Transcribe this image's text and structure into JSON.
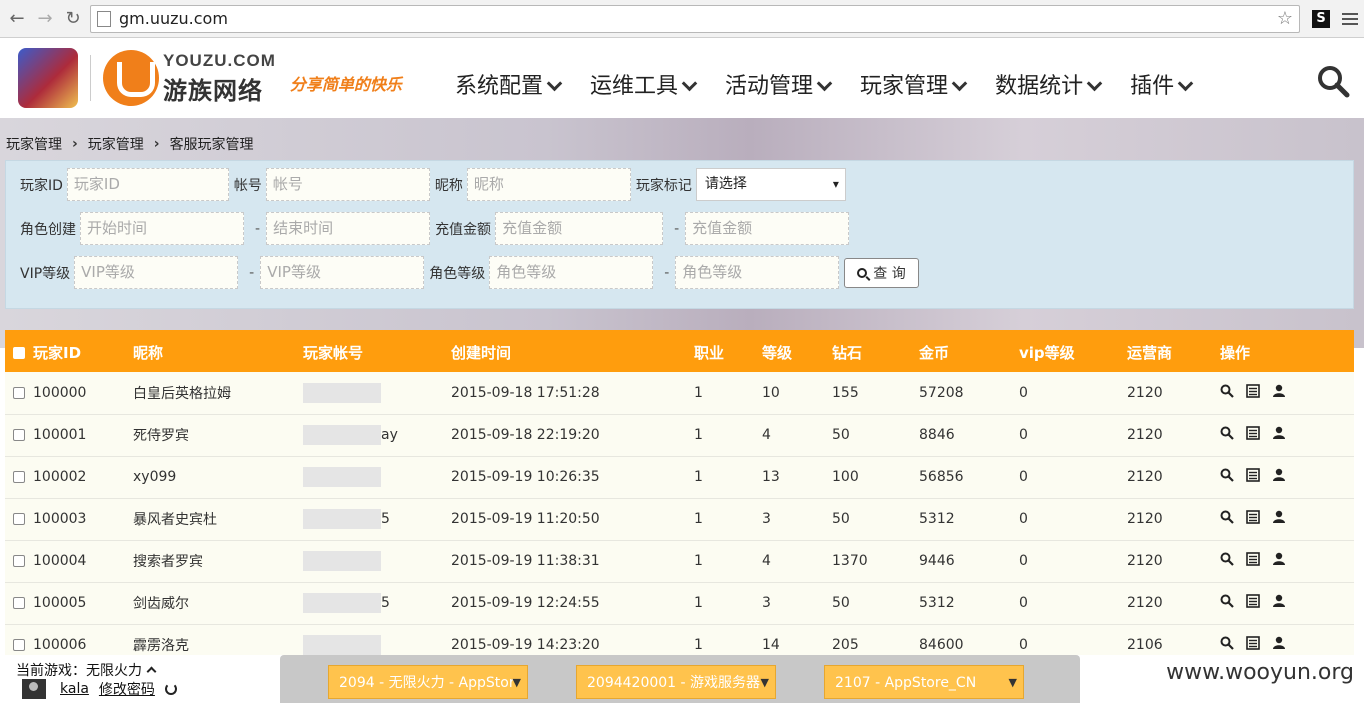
{
  "browser": {
    "url": "gm.uuzu.com"
  },
  "brand": {
    "en": "YOUZU.COM",
    "cn": "游族网络",
    "slogan": "分享简单的快乐"
  },
  "nav": [
    "系统配置",
    "运维工具",
    "活动管理",
    "玩家管理",
    "数据统计",
    "插件"
  ],
  "breadcrumb": [
    "玩家管理",
    "玩家管理",
    "客服玩家管理"
  ],
  "filter": {
    "player_id_label": "玩家ID",
    "player_id_placeholder": "玩家ID",
    "account_label": "帐号",
    "account_placeholder": "帐号",
    "nickname_label": "昵称",
    "nickname_placeholder": "昵称",
    "tag_label": "玩家标记",
    "tag_value": "请选择",
    "create_label": "角色创建",
    "start_placeholder": "开始时间",
    "end_placeholder": "结束时间",
    "recharge_label": "充值金额",
    "recharge_placeholder": "充值金额",
    "vip_label": "VIP等级",
    "vip_placeholder": "VIP等级",
    "role_level_label": "角色等级",
    "role_level_placeholder": "角色等级",
    "dash": "-",
    "query_label": "查 询"
  },
  "table": {
    "headers": [
      "玩家ID",
      "昵称",
      "玩家帐号",
      "创建时间",
      "职业",
      "等级",
      "钻石",
      "金币",
      "vip等级",
      "运营商",
      "操作"
    ],
    "rows": [
      {
        "id": "100000",
        "nickname": "白皇后英格拉姆",
        "account": "",
        "created": "2015-09-18 17:51:28",
        "job": "1",
        "level": "10",
        "diamond": "155",
        "gold": "57208",
        "vip": "0",
        "operator": "2120"
      },
      {
        "id": "100001",
        "nickname": "死侍罗宾",
        "account": "ay",
        "created": "2015-09-18 22:19:20",
        "job": "1",
        "level": "4",
        "diamond": "50",
        "gold": "8846",
        "vip": "0",
        "operator": "2120"
      },
      {
        "id": "100002",
        "nickname": "xy099",
        "account": "",
        "created": "2015-09-19 10:26:35",
        "job": "1",
        "level": "13",
        "diamond": "100",
        "gold": "56856",
        "vip": "0",
        "operator": "2120"
      },
      {
        "id": "100003",
        "nickname": "暴风者史宾杜",
        "account": "5",
        "created": "2015-09-19 11:20:50",
        "job": "1",
        "level": "3",
        "diamond": "50",
        "gold": "5312",
        "vip": "0",
        "operator": "2120"
      },
      {
        "id": "100004",
        "nickname": "搜索者罗宾",
        "account": "",
        "created": "2015-09-19 11:38:31",
        "job": "1",
        "level": "4",
        "diamond": "1370",
        "gold": "9446",
        "vip": "0",
        "operator": "2120"
      },
      {
        "id": "100005",
        "nickname": "剑齿威尔",
        "account": "5",
        "created": "2015-09-19 12:24:55",
        "job": "1",
        "level": "3",
        "diamond": "50",
        "gold": "5312",
        "vip": "0",
        "operator": "2120"
      },
      {
        "id": "100006",
        "nickname": "霹雳洛克",
        "account": "",
        "created": "2015-09-19 14:23:20",
        "job": "1",
        "level": "14",
        "diamond": "205",
        "gold": "84600",
        "vip": "0",
        "operator": "2106"
      }
    ]
  },
  "footer": {
    "current_game_label": "当前游戏：",
    "current_game": "无限火力",
    "username": "kala",
    "change_password": "修改密码",
    "selects": [
      "2094 - 无限火力 - AppStor",
      "2094420001 - 游戏服务器",
      "2107 - AppStore_CN"
    ]
  },
  "watermark": "www.wooyun.org"
}
